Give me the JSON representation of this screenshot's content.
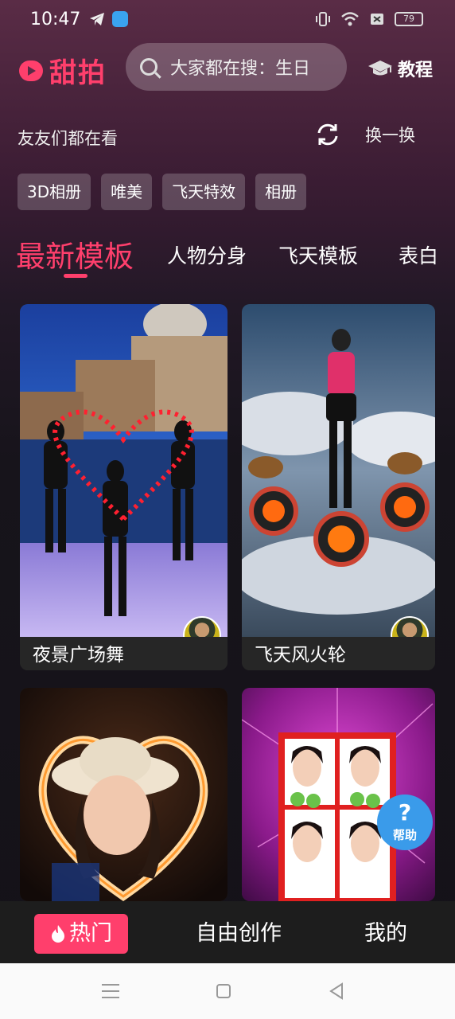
{
  "status_bar": {
    "time": "10:47",
    "battery": "79"
  },
  "header": {
    "app_name": "甜拍",
    "search_text": "大家都在搜：生日",
    "tutorial_label": "教程"
  },
  "section": {
    "title": "友友们都在看",
    "refresh_label": "换一换"
  },
  "tags": [
    "3D相册",
    "唯美",
    "飞天特效",
    "相册"
  ],
  "tabs": [
    {
      "label": "最新模板",
      "active": true
    },
    {
      "label": "人物分身",
      "active": false
    },
    {
      "label": "飞天模板",
      "active": false
    },
    {
      "label": "表白",
      "active": false
    }
  ],
  "cards": [
    {
      "title": "夜景广场舞"
    },
    {
      "title": "飞天风火轮"
    },
    {
      "title": ""
    },
    {
      "title": ""
    }
  ],
  "help_button": {
    "symbol": "?",
    "label": "帮助"
  },
  "bottom_nav": [
    {
      "label": "热门",
      "active": true
    },
    {
      "label": "自由创作",
      "active": false
    },
    {
      "label": "我的",
      "active": false
    }
  ],
  "colors": {
    "accent": "#ff3f6c",
    "help_blue": "#3a9bea"
  }
}
